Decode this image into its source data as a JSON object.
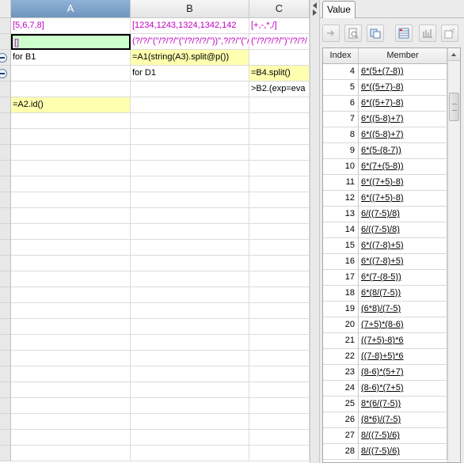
{
  "grid": {
    "columns": [
      "A",
      "B",
      "C"
    ],
    "cells": {
      "A1": "[5,6,7,8]",
      "B1": "[1234,1243,1324,1342,142",
      "C1": "[+,-,*,/]",
      "A2": "[]",
      "B2": "(?/?/\"(\"/?/?/\"(\"/?/?/?/\"))\",?/?/\"(\"/?/?/?/\"",
      "C2": "(\"/?/?/?/\")\"/?/?/",
      "A3": "for B1",
      "B3": "=A1(string(A3).split@p())",
      "C3": "",
      "A4": "",
      "B4": "for D1",
      "C4": "=B4.split()",
      "A5": "",
      "B5": "",
      "C5": ">B2.(exp=eva",
      "A6": "=A2.id()",
      "B6": "",
      "C6": ""
    }
  },
  "panel": {
    "tab_label": "Value",
    "toolbar_icons": [
      "arrow-right-icon",
      "zoom-icon",
      "copy-icon",
      "table-view-icon",
      "chart-icon",
      "settings-icon"
    ],
    "table": {
      "headers": [
        "Index",
        "Member"
      ],
      "rows": [
        {
          "index": "4",
          "member": "6*(5+(7-8))"
        },
        {
          "index": "5",
          "member": "6*((5+7)-8)"
        },
        {
          "index": "6",
          "member": "6*((5+7)-8)"
        },
        {
          "index": "7",
          "member": "6*((5-8)+7)"
        },
        {
          "index": "8",
          "member": "6*((5-8)+7)"
        },
        {
          "index": "9",
          "member": "6*(5-(8-7))"
        },
        {
          "index": "10",
          "member": "6*(7+(5-8))"
        },
        {
          "index": "11",
          "member": "6*((7+5)-8)"
        },
        {
          "index": "12",
          "member": "6*((7+5)-8)"
        },
        {
          "index": "13",
          "member": "6/((7-5)/8)"
        },
        {
          "index": "14",
          "member": "6/((7-5)/8)"
        },
        {
          "index": "15",
          "member": "6*((7-8)+5)"
        },
        {
          "index": "16",
          "member": "6*((7-8)+5)"
        },
        {
          "index": "17",
          "member": "6*(7-(8-5))"
        },
        {
          "index": "18",
          "member": "6*(8/(7-5))"
        },
        {
          "index": "19",
          "member": "(6*8)/(7-5)"
        },
        {
          "index": "20",
          "member": "(7+5)*(8-6)"
        },
        {
          "index": "21",
          "member": "((7+5)-8)*6"
        },
        {
          "index": "22",
          "member": "((7-8)+5)*6"
        },
        {
          "index": "23",
          "member": "(8-6)*(5+7)"
        },
        {
          "index": "24",
          "member": "(8-6)*(7+5)"
        },
        {
          "index": "25",
          "member": "8*(6/(7-5))"
        },
        {
          "index": "26",
          "member": "(8*6)/(7-5)"
        },
        {
          "index": "27",
          "member": "8/((7-5)/6)"
        },
        {
          "index": "28",
          "member": "8/((7-5)/6)"
        }
      ]
    }
  }
}
